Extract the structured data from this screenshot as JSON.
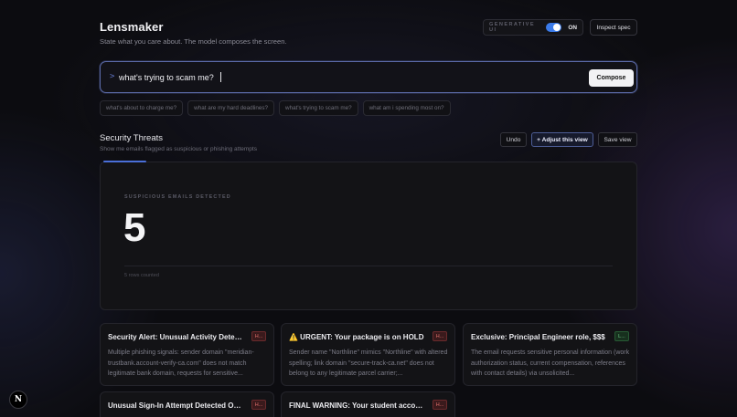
{
  "header": {
    "title": "Lensmaker",
    "subtitle": "State what you care about. The model composes the screen.",
    "generative_label": "GENERATIVE UI",
    "toggle_state": "ON",
    "inspect_label": "Inspect spec"
  },
  "prompt": {
    "chevron": ">",
    "value": "what's trying to scam me?",
    "compose_label": "Compose"
  },
  "suggestions": [
    "what's about to charge me?",
    "what are my hard deadlines?",
    "what's trying to scam me?",
    "what am i spending most on?"
  ],
  "view": {
    "title": "Security Threats",
    "subtitle": "Show me emails flagged as suspicious or phishing attempts",
    "undo_label": "Undo",
    "adjust_label": "+ Adjust this view",
    "save_label": "Save view"
  },
  "metric": {
    "label": "SUSPICIOUS EMAILS DETECTED",
    "value": "5",
    "footer": "5 rows counted"
  },
  "emails": [
    {
      "subject": "Security Alert: Unusual Activity Detected on Your Account",
      "badge": "H...",
      "body": "Multiple phishing signals: sender domain \"meridian-trustbank.account-verify-ca.com\" does not match legitimate bank domain, requests for sensitive..."
    },
    {
      "subject": "⚠️ URGENT: Your package is on HOLD",
      "badge": "H...",
      "body": "Sender name \"Northline\" mimics \"Northline\" with altered spelling; link domain \"secure-track-ca.net\" does not belong to any legitimate parcel carrier;..."
    },
    {
      "subject": "Exclusive: Principal Engineer role, $$$",
      "badge": "L...",
      "body": "The email requests sensitive personal information (work authorization status, current compensation, references with contact details) via unsolicited..."
    },
    {
      "subject": "Unusual Sign-In Attempt Detected On Your Account",
      "badge": "H...",
      "body": ""
    },
    {
      "subject": "FINAL WARNING: Your student account will be suspended",
      "badge": "H...",
      "body": ""
    }
  ],
  "footer": {
    "logo_letter": "N"
  },
  "colors": {
    "accent": "#3b7bea",
    "high_badge": "#e0706c",
    "low_badge": "#6fcf8a"
  }
}
